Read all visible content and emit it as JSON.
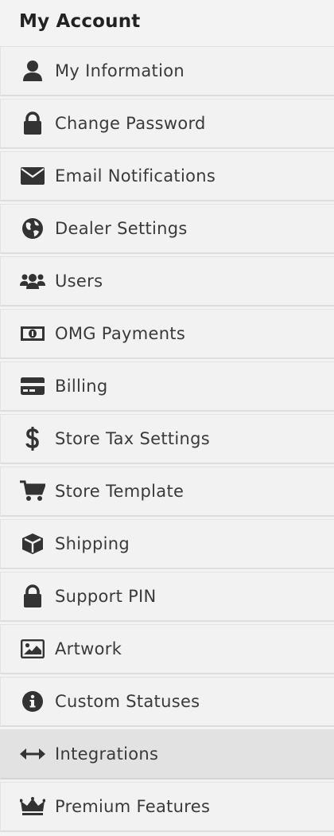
{
  "panel": {
    "title": "My Account"
  },
  "menu": {
    "active_index": 13,
    "items": [
      {
        "label": "My Information",
        "icon": "user-icon"
      },
      {
        "label": "Change Password",
        "icon": "lock-icon"
      },
      {
        "label": "Email Notifications",
        "icon": "envelope-icon"
      },
      {
        "label": "Dealer Settings",
        "icon": "globe-icon"
      },
      {
        "label": "Users",
        "icon": "users-icon"
      },
      {
        "label": "OMG Payments",
        "icon": "money-bill-icon"
      },
      {
        "label": "Billing",
        "icon": "credit-card-icon"
      },
      {
        "label": "Store Tax Settings",
        "icon": "dollar-icon"
      },
      {
        "label": "Store Template",
        "icon": "shopping-cart-icon"
      },
      {
        "label": "Shipping",
        "icon": "box-icon"
      },
      {
        "label": "Support PIN",
        "icon": "lock-icon"
      },
      {
        "label": "Artwork",
        "icon": "image-icon"
      },
      {
        "label": "Custom Statuses",
        "icon": "info-circle-icon"
      },
      {
        "label": "Integrations",
        "icon": "arrows-horizontal-icon"
      },
      {
        "label": "Premium Features",
        "icon": "crown-icon"
      }
    ]
  },
  "colors": {
    "panel_bg": "#f3f3f3",
    "item_bg": "#f2f2f2",
    "active_bg": "#e2e2e2",
    "icon": "#333333",
    "text": "#3a3a3a"
  }
}
